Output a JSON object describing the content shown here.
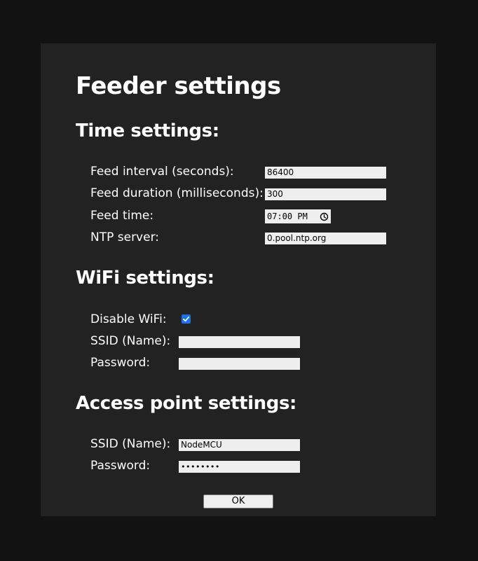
{
  "title": "Feeder settings",
  "time_settings": {
    "heading": "Time settings:",
    "feed_interval": {
      "label": "Feed interval (seconds):",
      "value": "86400"
    },
    "feed_duration": {
      "label": "Feed duration (milliseconds):",
      "value": "300"
    },
    "feed_time": {
      "label": "Feed time:",
      "value": "07:00 PM"
    },
    "ntp_server": {
      "label": "NTP server:",
      "value": "0.pool.ntp.org"
    }
  },
  "wifi_settings": {
    "heading": "WiFi settings:",
    "disable_wifi": {
      "label": "Disable WiFi:",
      "checked": true
    },
    "ssid": {
      "label": "SSID (Name):",
      "value": ""
    },
    "password": {
      "label": "Password:",
      "value": ""
    }
  },
  "ap_settings": {
    "heading": "Access point settings:",
    "ssid": {
      "label": "SSID (Name):",
      "value": "NodeMCU"
    },
    "password": {
      "label": "Password:",
      "value": "••••••••"
    }
  },
  "ok_label": "OK",
  "colors": {
    "page_bg": "#121212",
    "card_bg": "#222222",
    "field_bg": "#eeeeee",
    "checkbox_accent": "#1a73e8"
  }
}
